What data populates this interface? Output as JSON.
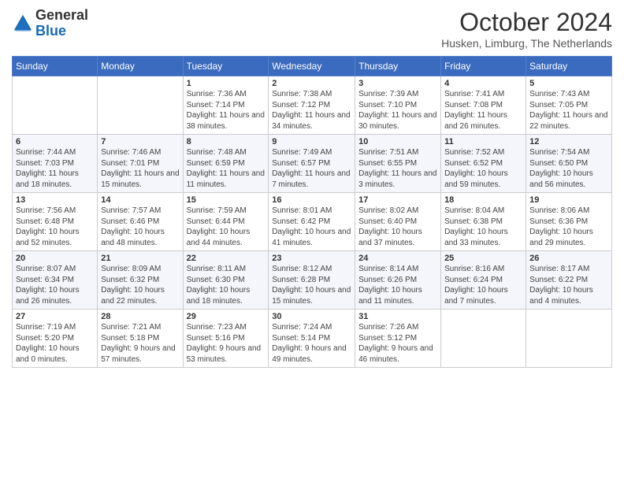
{
  "logo": {
    "general": "General",
    "blue": "Blue"
  },
  "header": {
    "month": "October 2024",
    "location": "Husken, Limburg, The Netherlands"
  },
  "weekdays": [
    "Sunday",
    "Monday",
    "Tuesday",
    "Wednesday",
    "Thursday",
    "Friday",
    "Saturday"
  ],
  "weeks": [
    [
      {
        "day": "",
        "info": ""
      },
      {
        "day": "",
        "info": ""
      },
      {
        "day": "1",
        "info": "Sunrise: 7:36 AM\nSunset: 7:14 PM\nDaylight: 11 hours and 38 minutes."
      },
      {
        "day": "2",
        "info": "Sunrise: 7:38 AM\nSunset: 7:12 PM\nDaylight: 11 hours and 34 minutes."
      },
      {
        "day": "3",
        "info": "Sunrise: 7:39 AM\nSunset: 7:10 PM\nDaylight: 11 hours and 30 minutes."
      },
      {
        "day": "4",
        "info": "Sunrise: 7:41 AM\nSunset: 7:08 PM\nDaylight: 11 hours and 26 minutes."
      },
      {
        "day": "5",
        "info": "Sunrise: 7:43 AM\nSunset: 7:05 PM\nDaylight: 11 hours and 22 minutes."
      }
    ],
    [
      {
        "day": "6",
        "info": "Sunrise: 7:44 AM\nSunset: 7:03 PM\nDaylight: 11 hours and 18 minutes."
      },
      {
        "day": "7",
        "info": "Sunrise: 7:46 AM\nSunset: 7:01 PM\nDaylight: 11 hours and 15 minutes."
      },
      {
        "day": "8",
        "info": "Sunrise: 7:48 AM\nSunset: 6:59 PM\nDaylight: 11 hours and 11 minutes."
      },
      {
        "day": "9",
        "info": "Sunrise: 7:49 AM\nSunset: 6:57 PM\nDaylight: 11 hours and 7 minutes."
      },
      {
        "day": "10",
        "info": "Sunrise: 7:51 AM\nSunset: 6:55 PM\nDaylight: 11 hours and 3 minutes."
      },
      {
        "day": "11",
        "info": "Sunrise: 7:52 AM\nSunset: 6:52 PM\nDaylight: 10 hours and 59 minutes."
      },
      {
        "day": "12",
        "info": "Sunrise: 7:54 AM\nSunset: 6:50 PM\nDaylight: 10 hours and 56 minutes."
      }
    ],
    [
      {
        "day": "13",
        "info": "Sunrise: 7:56 AM\nSunset: 6:48 PM\nDaylight: 10 hours and 52 minutes."
      },
      {
        "day": "14",
        "info": "Sunrise: 7:57 AM\nSunset: 6:46 PM\nDaylight: 10 hours and 48 minutes."
      },
      {
        "day": "15",
        "info": "Sunrise: 7:59 AM\nSunset: 6:44 PM\nDaylight: 10 hours and 44 minutes."
      },
      {
        "day": "16",
        "info": "Sunrise: 8:01 AM\nSunset: 6:42 PM\nDaylight: 10 hours and 41 minutes."
      },
      {
        "day": "17",
        "info": "Sunrise: 8:02 AM\nSunset: 6:40 PM\nDaylight: 10 hours and 37 minutes."
      },
      {
        "day": "18",
        "info": "Sunrise: 8:04 AM\nSunset: 6:38 PM\nDaylight: 10 hours and 33 minutes."
      },
      {
        "day": "19",
        "info": "Sunrise: 8:06 AM\nSunset: 6:36 PM\nDaylight: 10 hours and 29 minutes."
      }
    ],
    [
      {
        "day": "20",
        "info": "Sunrise: 8:07 AM\nSunset: 6:34 PM\nDaylight: 10 hours and 26 minutes."
      },
      {
        "day": "21",
        "info": "Sunrise: 8:09 AM\nSunset: 6:32 PM\nDaylight: 10 hours and 22 minutes."
      },
      {
        "day": "22",
        "info": "Sunrise: 8:11 AM\nSunset: 6:30 PM\nDaylight: 10 hours and 18 minutes."
      },
      {
        "day": "23",
        "info": "Sunrise: 8:12 AM\nSunset: 6:28 PM\nDaylight: 10 hours and 15 minutes."
      },
      {
        "day": "24",
        "info": "Sunrise: 8:14 AM\nSunset: 6:26 PM\nDaylight: 10 hours and 11 minutes."
      },
      {
        "day": "25",
        "info": "Sunrise: 8:16 AM\nSunset: 6:24 PM\nDaylight: 10 hours and 7 minutes."
      },
      {
        "day": "26",
        "info": "Sunrise: 8:17 AM\nSunset: 6:22 PM\nDaylight: 10 hours and 4 minutes."
      }
    ],
    [
      {
        "day": "27",
        "info": "Sunrise: 7:19 AM\nSunset: 5:20 PM\nDaylight: 10 hours and 0 minutes."
      },
      {
        "day": "28",
        "info": "Sunrise: 7:21 AM\nSunset: 5:18 PM\nDaylight: 9 hours and 57 minutes."
      },
      {
        "day": "29",
        "info": "Sunrise: 7:23 AM\nSunset: 5:16 PM\nDaylight: 9 hours and 53 minutes."
      },
      {
        "day": "30",
        "info": "Sunrise: 7:24 AM\nSunset: 5:14 PM\nDaylight: 9 hours and 49 minutes."
      },
      {
        "day": "31",
        "info": "Sunrise: 7:26 AM\nSunset: 5:12 PM\nDaylight: 9 hours and 46 minutes."
      },
      {
        "day": "",
        "info": ""
      },
      {
        "day": "",
        "info": ""
      }
    ]
  ]
}
